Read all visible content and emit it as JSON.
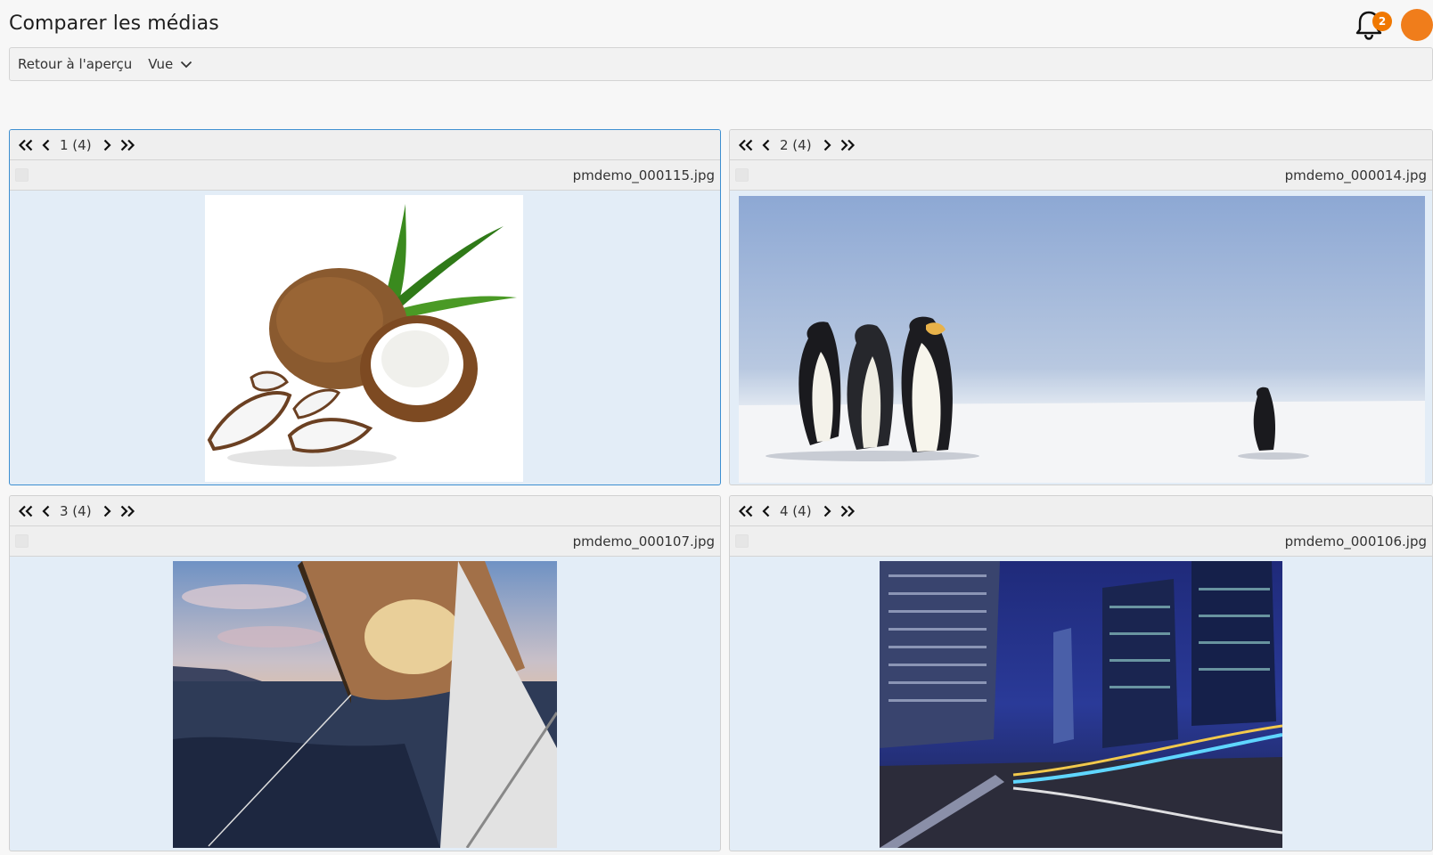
{
  "page": {
    "title": "Comparer les médias"
  },
  "header": {
    "notifications_count": "2"
  },
  "toolbar": {
    "back_label": "Retour à l'aperçu",
    "view_label": "Vue"
  },
  "panels": [
    {
      "position": "1 (4)",
      "filename": "pmdemo_000115.jpg",
      "image": "coconut-photo"
    },
    {
      "position": "2 (4)",
      "filename": "pmdemo_000014.jpg",
      "image": "penguins-photo"
    },
    {
      "position": "3 (4)",
      "filename": "pmdemo_000107.jpg",
      "image": "sailboat-photo"
    },
    {
      "position": "4 (4)",
      "filename": "pmdemo_000106.jpg",
      "image": "city-night-photo"
    }
  ],
  "colors": {
    "accent": "#f07800",
    "active_border": "#3d8fd1",
    "panel_bg": "#e3edf7"
  }
}
